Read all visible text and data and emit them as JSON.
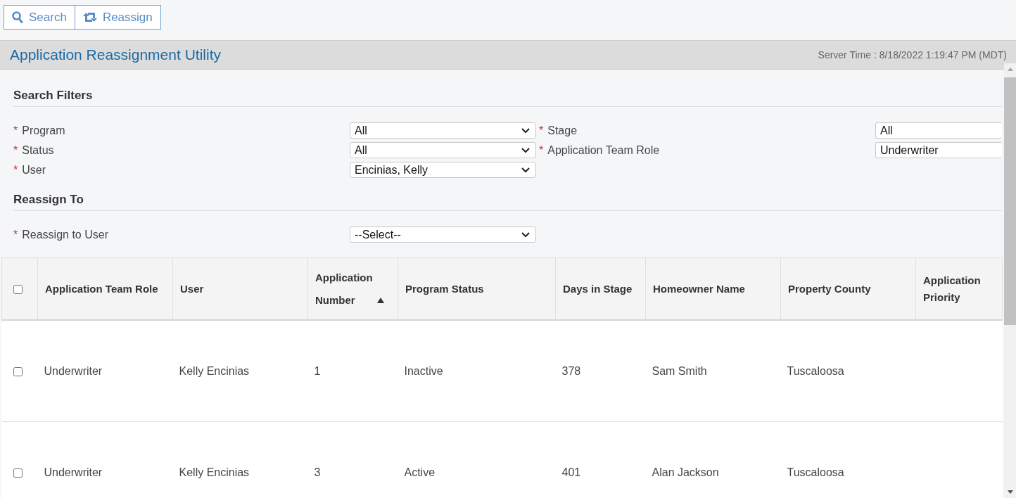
{
  "toolbar": {
    "buttons": [
      {
        "kind": "search",
        "label": "Search"
      },
      {
        "kind": "reassign",
        "label": "Reassign"
      }
    ]
  },
  "header": {
    "title": "Application Reassignment Utility",
    "server_time": "Server Time : 8/18/2022 1:19:47 PM (MDT)"
  },
  "search_filters": {
    "heading": "Search Filters",
    "fields": [
      {
        "marker": "*",
        "label": "Program",
        "value": "All"
      },
      {
        "marker": "*",
        "label": "Stage",
        "value": "All"
      },
      {
        "marker": "*",
        "label": "Status",
        "value": "All"
      },
      {
        "marker": "*",
        "label": "Application Team Role",
        "value": "Underwriter"
      },
      {
        "marker": "*",
        "label": "User",
        "value": "Encinias, Kelly"
      }
    ]
  },
  "reassign_to": {
    "heading": "Reassign To",
    "fields": [
      {
        "marker": "*",
        "label": "Reassign to User",
        "value": "--Select--"
      }
    ]
  },
  "table": {
    "select_all": {
      "checked": false
    },
    "columns": [
      {
        "label": "Application Team Role",
        "sorted": false
      },
      {
        "label": "User",
        "sorted": false
      },
      {
        "label": "Application Number",
        "sorted": true
      },
      {
        "label": "Program Status",
        "sorted": false
      },
      {
        "label": "Days in Stage",
        "sorted": false
      },
      {
        "label": "Homeowner Name",
        "sorted": false
      },
      {
        "label": "Property County",
        "sorted": false
      },
      {
        "label": "Application Priority",
        "sorted": false
      }
    ],
    "rows": [
      {
        "checked": false,
        "cells": [
          "Underwriter",
          "Kelly Encinias",
          "1",
          "Inactive",
          "378",
          "Sam Smith",
          "Tuscaloosa"
        ]
      },
      {
        "checked": false,
        "cells": [
          "Underwriter",
          "Kelly Encinias",
          "3",
          "Active",
          "401",
          "Alan Jackson",
          "Tuscaloosa"
        ]
      }
    ]
  }
}
